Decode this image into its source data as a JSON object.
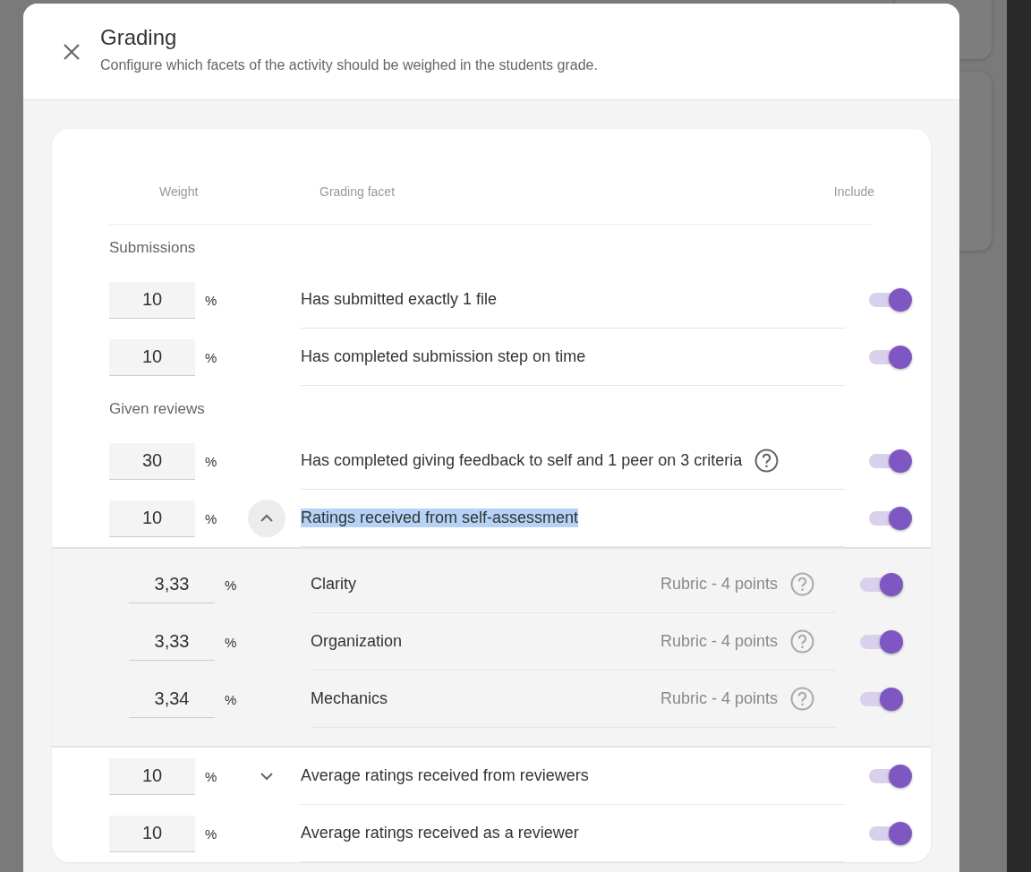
{
  "dialog": {
    "title": "Grading",
    "subtitle": "Configure which facets of the activity should be weighed in the students grade."
  },
  "columns": {
    "weight": "Weight",
    "facet": "Grading facet",
    "include": "Include"
  },
  "sections": [
    {
      "title": "Submissions",
      "facets": [
        {
          "weight": "10",
          "unit": "%",
          "label": "Has submitted exactly 1 file",
          "help": false,
          "highlighted": false,
          "expandable": false,
          "included": true
        },
        {
          "weight": "10",
          "unit": "%",
          "label": "Has completed submission step on time",
          "help": false,
          "highlighted": false,
          "expandable": false,
          "included": true
        }
      ]
    },
    {
      "title": "Given reviews",
      "facets": [
        {
          "weight": "30",
          "unit": "%",
          "label": "Has completed giving feedback to self and 1 peer on 3 criteria",
          "help": true,
          "highlighted": false,
          "expandable": false,
          "included": true
        },
        {
          "weight": "10",
          "unit": "%",
          "label": "Ratings received from self-assessment",
          "help": false,
          "highlighted": true,
          "expandable": true,
          "expanded": true,
          "included": true,
          "children": [
            {
              "weight": "3,33",
              "unit": "%",
              "label": "Clarity",
              "detail": "Rubric - 4 points",
              "included": true
            },
            {
              "weight": "3,33",
              "unit": "%",
              "label": "Organization",
              "detail": "Rubric - 4 points",
              "included": true
            },
            {
              "weight": "3,34",
              "unit": "%",
              "label": "Mechanics",
              "detail": "Rubric - 4 points",
              "included": true
            }
          ]
        },
        {
          "weight": "10",
          "unit": "%",
          "label": "Average ratings received from reviewers",
          "help": false,
          "highlighted": false,
          "expandable": true,
          "expanded": false,
          "included": true
        },
        {
          "weight": "10",
          "unit": "%",
          "label": "Average ratings received as a reviewer",
          "help": false,
          "highlighted": false,
          "expandable": false,
          "included": true
        }
      ]
    }
  ]
}
